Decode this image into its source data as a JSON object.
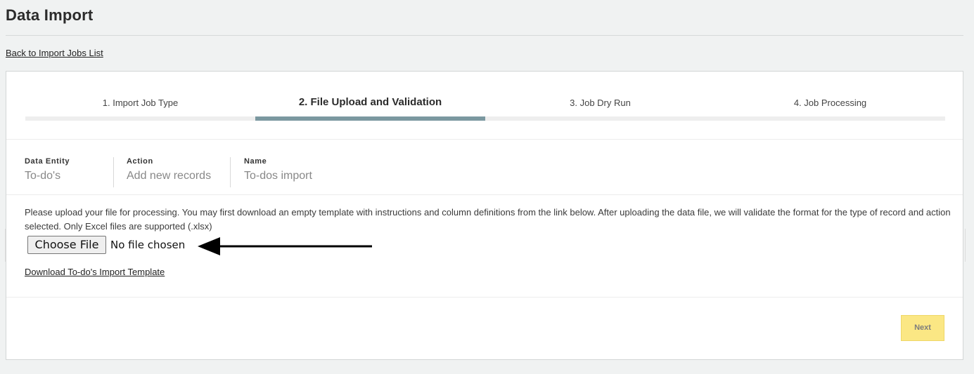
{
  "page": {
    "title": "Data Import",
    "back_link": "Back to Import Jobs List"
  },
  "stepper": {
    "steps": [
      {
        "label": "1. Import Job Type",
        "active": false
      },
      {
        "label": "2. File Upload and Validation",
        "active": true
      },
      {
        "label": "3. Job Dry Run",
        "active": false
      },
      {
        "label": "4. Job Processing",
        "active": false
      }
    ],
    "active_color": "#7b98a0"
  },
  "meta": {
    "data_entity": {
      "label": "Data Entity",
      "value": "To-do's"
    },
    "action": {
      "label": "Action",
      "value": "Add new records"
    },
    "name": {
      "label": "Name",
      "value": "To-dos import"
    }
  },
  "upload": {
    "description": "Please upload your file for processing. You may first download an empty template with instructions and column definitions from the link below. After uploading the data file, we will validate the format for the type of record and action selected. Only Excel files are supported (.xlsx)",
    "choose_file_label": "Choose File",
    "no_file_text": "No file chosen",
    "template_link": "Download To-do's Import Template"
  },
  "footer": {
    "next_label": "Next",
    "next_color": "#fbe784"
  }
}
